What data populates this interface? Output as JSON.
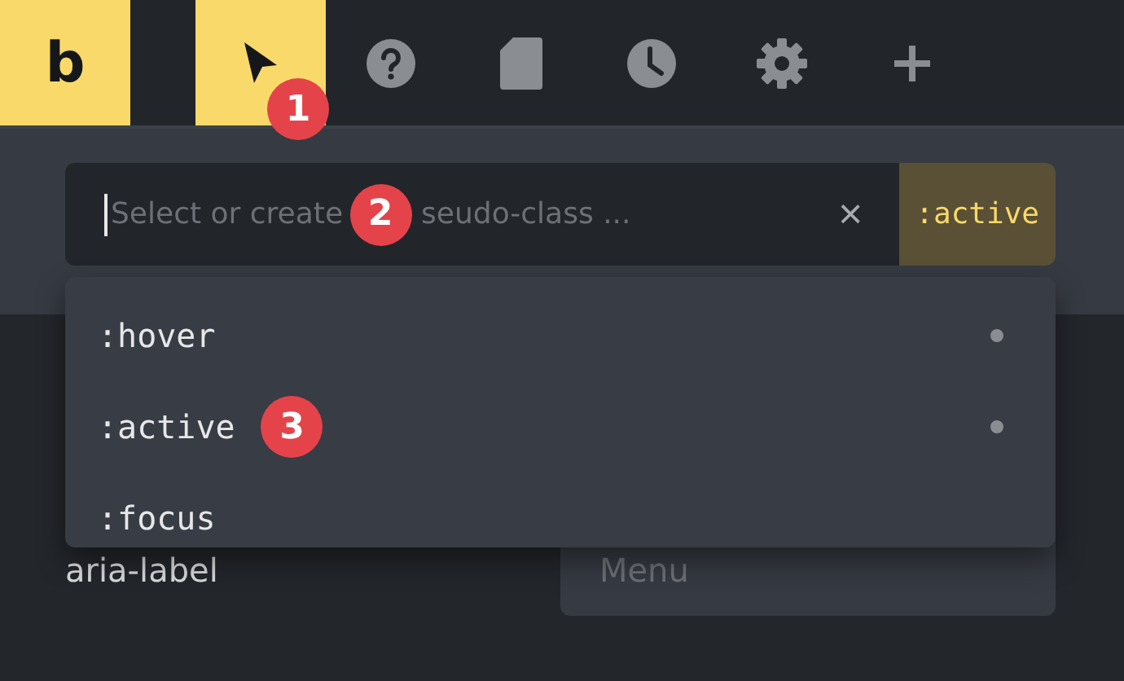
{
  "logo": {
    "text": "b"
  },
  "toolbar": [
    {
      "kind": "pointer",
      "selected": true
    },
    {
      "kind": "help",
      "selected": false
    },
    {
      "kind": "page",
      "selected": false
    },
    {
      "kind": "history",
      "selected": false
    },
    {
      "kind": "settings",
      "selected": false
    },
    {
      "kind": "add",
      "selected": false
    }
  ],
  "pseudo_field": {
    "placeholder_fragments": [
      "Select or create",
      "seudo-class ..."
    ],
    "clear": "×",
    "active_tag": ":active"
  },
  "dropdown": [
    {
      "label": ":hover",
      "in_use": true
    },
    {
      "label": ":active",
      "in_use": true
    },
    {
      "label": ":focus",
      "in_use": false
    }
  ],
  "attribute": {
    "label": "aria-label",
    "placeholder": "Menu"
  },
  "callouts": [
    "1",
    "2",
    "3"
  ]
}
